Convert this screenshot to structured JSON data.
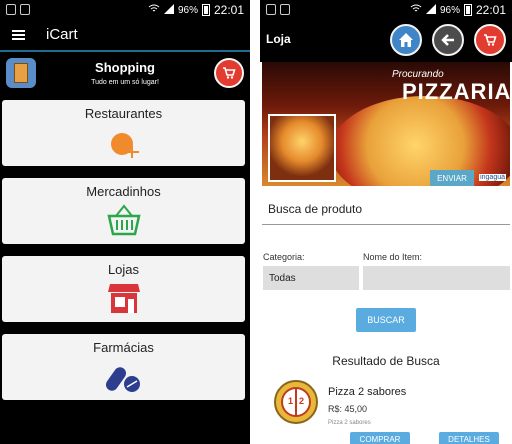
{
  "left_screen": {
    "status": {
      "battery": "96%",
      "time": "22:01"
    },
    "app_title": "iCart",
    "header": {
      "title": "Shopping",
      "subtitle": "Tudo em um só lugar!"
    },
    "categories": [
      {
        "label": "Restaurantes",
        "icon": "restaurant-icon"
      },
      {
        "label": "Mercadinhos",
        "icon": "basket-icon"
      },
      {
        "label": "Lojas",
        "icon": "store-icon"
      },
      {
        "label": "Farmácias",
        "icon": "pills-icon"
      }
    ]
  },
  "right_screen": {
    "status": {
      "battery": "96%",
      "time": "22:01"
    },
    "title": "Loja",
    "banner": {
      "small_text": "Procurando",
      "big_text": "PIZZARIAS?",
      "button": "ENVIAR",
      "brand": "ingaguá"
    },
    "search": {
      "title": "Busca de produto",
      "category_label": "Categoria:",
      "category_value": "Todas",
      "item_label": "Nome do Item:",
      "item_value": "",
      "button": "BUSCAR"
    },
    "results": {
      "title": "Resultado de Busca",
      "items": [
        {
          "name": "Pizza 2 sabores",
          "price": "R$: 45,00",
          "subtitle": "Pizza 2 sabores",
          "icon_text_1": "1",
          "icon_text_2": "2",
          "buy_button": "COMPRAR",
          "details_button": "DETALHES"
        }
      ]
    }
  },
  "colors": {
    "cart_red": "#e23b30",
    "home_blue": "#3f86c9",
    "button_blue": "#5aace0",
    "appbar_line": "#1e6c8f"
  }
}
